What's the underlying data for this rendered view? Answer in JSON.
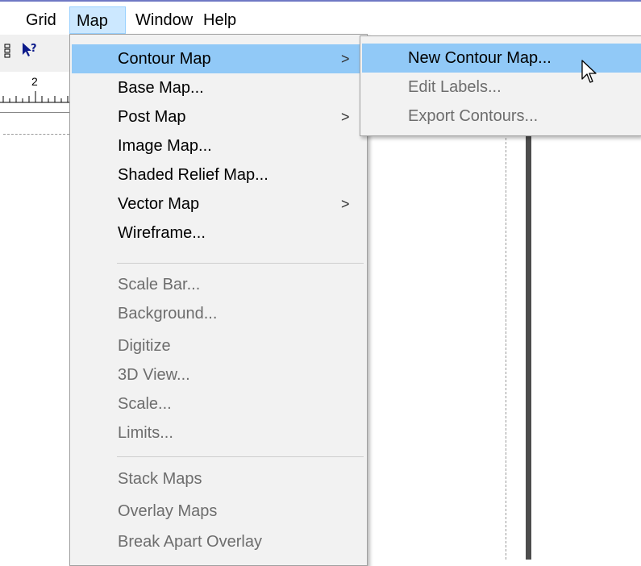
{
  "menubar": {
    "items": [
      {
        "label": "Grid"
      },
      {
        "label": "Map",
        "active": true
      },
      {
        "label": "Window"
      },
      {
        "label": "Help"
      }
    ]
  },
  "toolbar": {
    "icons": [
      "zoom-icon",
      "context-help-icon"
    ],
    "help_glyph": "?"
  },
  "ruler": {
    "label": "2"
  },
  "map_menu": {
    "items": [
      {
        "label": "Contour Map",
        "submenu": true,
        "enabled": true,
        "highlighted": true
      },
      {
        "label": "Base Map...",
        "enabled": true
      },
      {
        "label": "Post Map",
        "submenu": true,
        "enabled": true
      },
      {
        "label": "Image Map...",
        "enabled": true
      },
      {
        "label": "Shaded Relief Map...",
        "enabled": true
      },
      {
        "label": "Vector Map",
        "submenu": true,
        "enabled": true
      },
      {
        "label": "Wireframe...",
        "enabled": true
      },
      {
        "label": "Scale Bar...",
        "enabled": false
      },
      {
        "label": "Background...",
        "enabled": false
      },
      {
        "label": "Digitize",
        "enabled": false
      },
      {
        "label": "3D View...",
        "enabled": false
      },
      {
        "label": "Scale...",
        "enabled": false
      },
      {
        "label": "Limits...",
        "enabled": false
      },
      {
        "label": "Stack Maps",
        "enabled": false
      },
      {
        "label": "Overlay Maps",
        "enabled": false
      },
      {
        "label": "Break Apart Overlay",
        "enabled": false
      }
    ],
    "submenu_arrow": ">"
  },
  "contour_submenu": {
    "items": [
      {
        "label": "New Contour Map...",
        "enabled": true,
        "highlighted": true
      },
      {
        "label": "Edit Labels...",
        "enabled": false
      },
      {
        "label": "Export Contours...",
        "enabled": false
      }
    ]
  },
  "colors": {
    "highlight": "#91c9f7",
    "menu_bg": "#f2f2f2",
    "disabled_text": "#6d6d6d",
    "menubar_active_bg": "#cce8ff",
    "top_border": "#6f78c4"
  }
}
